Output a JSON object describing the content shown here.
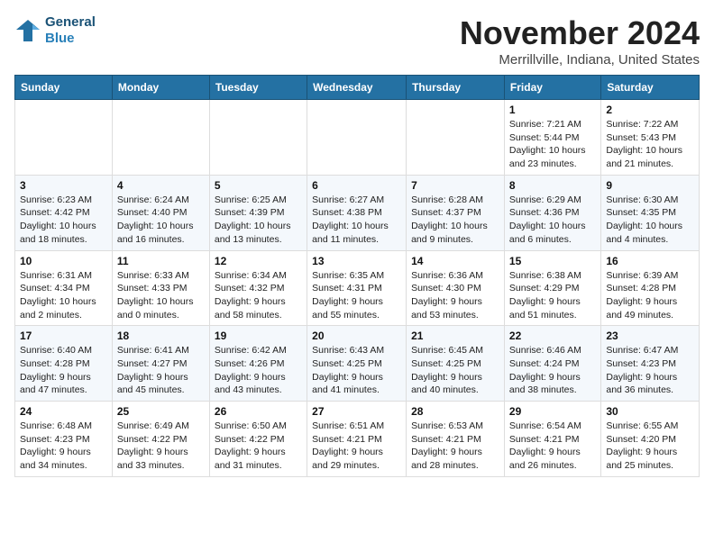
{
  "logo": {
    "line1": "General",
    "line2": "Blue"
  },
  "title": "November 2024",
  "location": "Merrillville, Indiana, United States",
  "weekdays": [
    "Sunday",
    "Monday",
    "Tuesday",
    "Wednesday",
    "Thursday",
    "Friday",
    "Saturday"
  ],
  "weeks": [
    [
      {
        "day": "",
        "info": ""
      },
      {
        "day": "",
        "info": ""
      },
      {
        "day": "",
        "info": ""
      },
      {
        "day": "",
        "info": ""
      },
      {
        "day": "",
        "info": ""
      },
      {
        "day": "1",
        "info": "Sunrise: 7:21 AM\nSunset: 5:44 PM\nDaylight: 10 hours and 23 minutes."
      },
      {
        "day": "2",
        "info": "Sunrise: 7:22 AM\nSunset: 5:43 PM\nDaylight: 10 hours and 21 minutes."
      }
    ],
    [
      {
        "day": "3",
        "info": "Sunrise: 6:23 AM\nSunset: 4:42 PM\nDaylight: 10 hours and 18 minutes."
      },
      {
        "day": "4",
        "info": "Sunrise: 6:24 AM\nSunset: 4:40 PM\nDaylight: 10 hours and 16 minutes."
      },
      {
        "day": "5",
        "info": "Sunrise: 6:25 AM\nSunset: 4:39 PM\nDaylight: 10 hours and 13 minutes."
      },
      {
        "day": "6",
        "info": "Sunrise: 6:27 AM\nSunset: 4:38 PM\nDaylight: 10 hours and 11 minutes."
      },
      {
        "day": "7",
        "info": "Sunrise: 6:28 AM\nSunset: 4:37 PM\nDaylight: 10 hours and 9 minutes."
      },
      {
        "day": "8",
        "info": "Sunrise: 6:29 AM\nSunset: 4:36 PM\nDaylight: 10 hours and 6 minutes."
      },
      {
        "day": "9",
        "info": "Sunrise: 6:30 AM\nSunset: 4:35 PM\nDaylight: 10 hours and 4 minutes."
      }
    ],
    [
      {
        "day": "10",
        "info": "Sunrise: 6:31 AM\nSunset: 4:34 PM\nDaylight: 10 hours and 2 minutes."
      },
      {
        "day": "11",
        "info": "Sunrise: 6:33 AM\nSunset: 4:33 PM\nDaylight: 10 hours and 0 minutes."
      },
      {
        "day": "12",
        "info": "Sunrise: 6:34 AM\nSunset: 4:32 PM\nDaylight: 9 hours and 58 minutes."
      },
      {
        "day": "13",
        "info": "Sunrise: 6:35 AM\nSunset: 4:31 PM\nDaylight: 9 hours and 55 minutes."
      },
      {
        "day": "14",
        "info": "Sunrise: 6:36 AM\nSunset: 4:30 PM\nDaylight: 9 hours and 53 minutes."
      },
      {
        "day": "15",
        "info": "Sunrise: 6:38 AM\nSunset: 4:29 PM\nDaylight: 9 hours and 51 minutes."
      },
      {
        "day": "16",
        "info": "Sunrise: 6:39 AM\nSunset: 4:28 PM\nDaylight: 9 hours and 49 minutes."
      }
    ],
    [
      {
        "day": "17",
        "info": "Sunrise: 6:40 AM\nSunset: 4:28 PM\nDaylight: 9 hours and 47 minutes."
      },
      {
        "day": "18",
        "info": "Sunrise: 6:41 AM\nSunset: 4:27 PM\nDaylight: 9 hours and 45 minutes."
      },
      {
        "day": "19",
        "info": "Sunrise: 6:42 AM\nSunset: 4:26 PM\nDaylight: 9 hours and 43 minutes."
      },
      {
        "day": "20",
        "info": "Sunrise: 6:43 AM\nSunset: 4:25 PM\nDaylight: 9 hours and 41 minutes."
      },
      {
        "day": "21",
        "info": "Sunrise: 6:45 AM\nSunset: 4:25 PM\nDaylight: 9 hours and 40 minutes."
      },
      {
        "day": "22",
        "info": "Sunrise: 6:46 AM\nSunset: 4:24 PM\nDaylight: 9 hours and 38 minutes."
      },
      {
        "day": "23",
        "info": "Sunrise: 6:47 AM\nSunset: 4:23 PM\nDaylight: 9 hours and 36 minutes."
      }
    ],
    [
      {
        "day": "24",
        "info": "Sunrise: 6:48 AM\nSunset: 4:23 PM\nDaylight: 9 hours and 34 minutes."
      },
      {
        "day": "25",
        "info": "Sunrise: 6:49 AM\nSunset: 4:22 PM\nDaylight: 9 hours and 33 minutes."
      },
      {
        "day": "26",
        "info": "Sunrise: 6:50 AM\nSunset: 4:22 PM\nDaylight: 9 hours and 31 minutes."
      },
      {
        "day": "27",
        "info": "Sunrise: 6:51 AM\nSunset: 4:21 PM\nDaylight: 9 hours and 29 minutes."
      },
      {
        "day": "28",
        "info": "Sunrise: 6:53 AM\nSunset: 4:21 PM\nDaylight: 9 hours and 28 minutes."
      },
      {
        "day": "29",
        "info": "Sunrise: 6:54 AM\nSunset: 4:21 PM\nDaylight: 9 hours and 26 minutes."
      },
      {
        "day": "30",
        "info": "Sunrise: 6:55 AM\nSunset: 4:20 PM\nDaylight: 9 hours and 25 minutes."
      }
    ]
  ]
}
